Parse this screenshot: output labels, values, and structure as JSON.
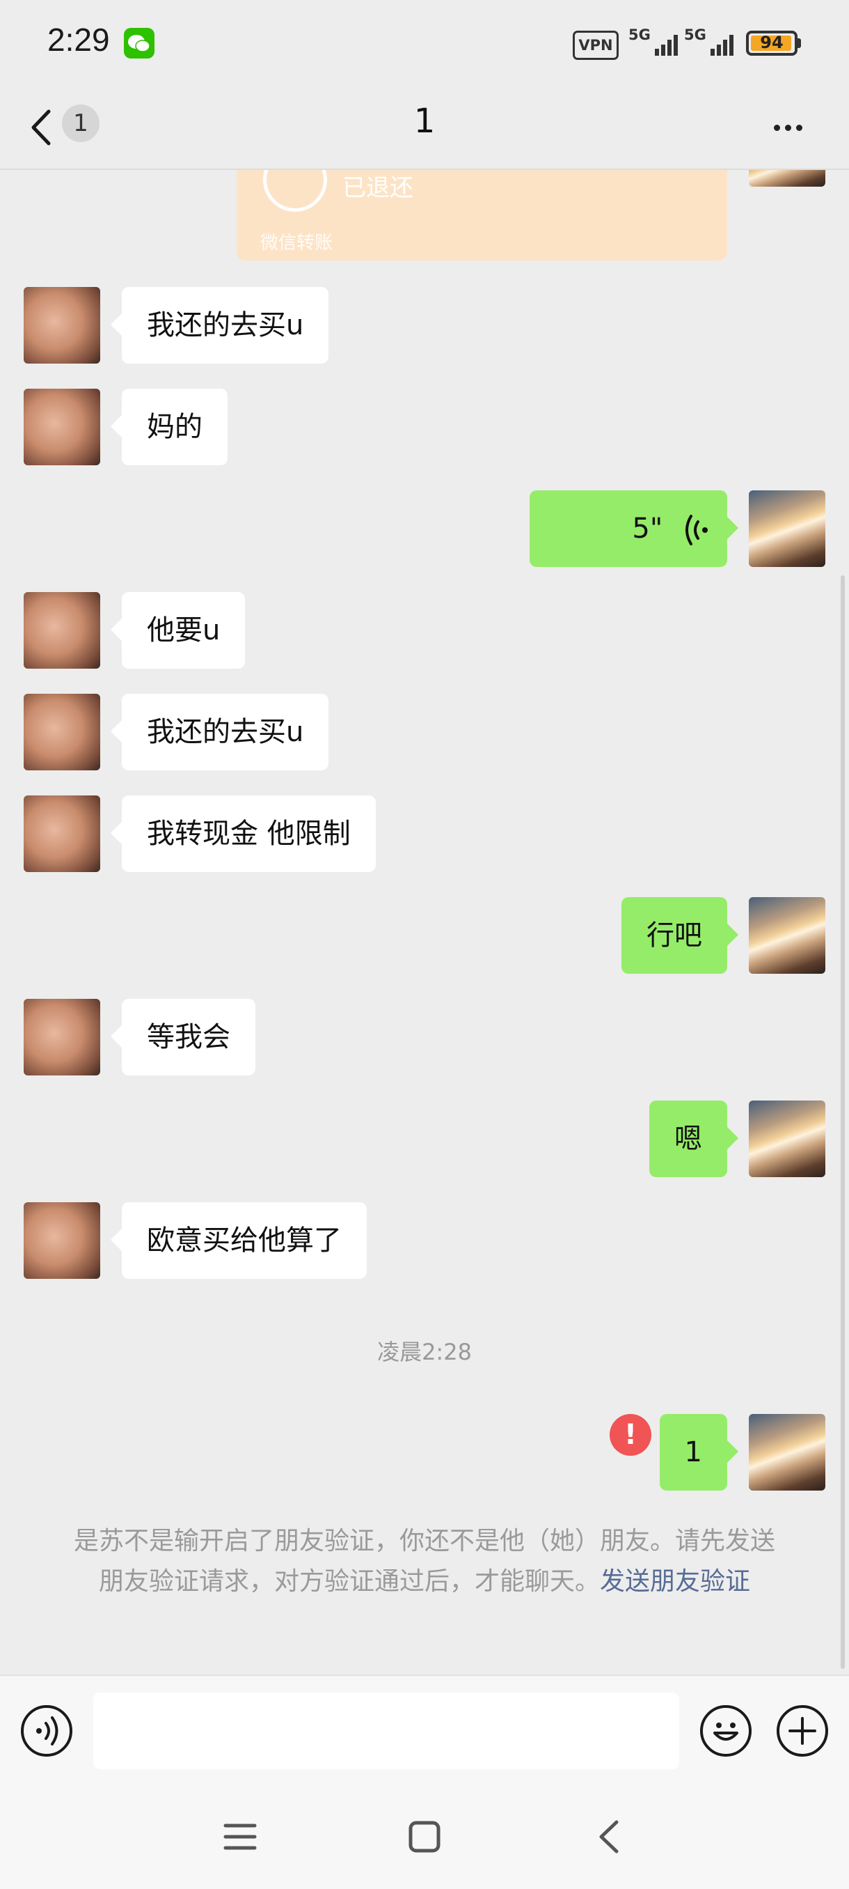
{
  "status_bar": {
    "time": "2:29",
    "vpn": "VPN",
    "sim1": "5G",
    "sim2": "5G",
    "battery": "94",
    "battery_level": 0.94
  },
  "header": {
    "unread_count": "1",
    "title": "1"
  },
  "transfer_card": {
    "status": "已退还",
    "label": "微信转账"
  },
  "messages": [
    {
      "side": "in",
      "text": "我还的去买u"
    },
    {
      "side": "in",
      "text": "妈的"
    },
    {
      "side": "out",
      "type": "voice",
      "text": "5\""
    },
    {
      "side": "in",
      "text": "他要u"
    },
    {
      "side": "in",
      "text": "我还的去买u"
    },
    {
      "side": "in",
      "text": "我转现金 他限制"
    },
    {
      "side": "out",
      "text": "行吧"
    },
    {
      "side": "in",
      "text": "等我会"
    },
    {
      "side": "out",
      "text": "嗯"
    },
    {
      "side": "in",
      "text": "欧意买给他算了"
    },
    {
      "side": "out",
      "text": "1",
      "failed": true
    }
  ],
  "timestamp": "凌晨2:28",
  "error_mark": "!",
  "notice": {
    "text": "是苏不是输开启了朋友验证，你还不是他（她）朋友。请先发送朋友验证请求，对方验证通过后，才能聊天。",
    "link": "发送朋友验证"
  },
  "input": {
    "value": "",
    "placeholder": ""
  },
  "icons": {
    "voice_toggle": "voice-mode-icon",
    "emoji": "emoji-icon",
    "plus": "plus-icon"
  },
  "colors": {
    "outgoing_bubble": "#95ec69",
    "incoming_bubble": "#ffffff",
    "link": "#576b95",
    "error": "#f05454",
    "wechat": "#2dc100"
  }
}
